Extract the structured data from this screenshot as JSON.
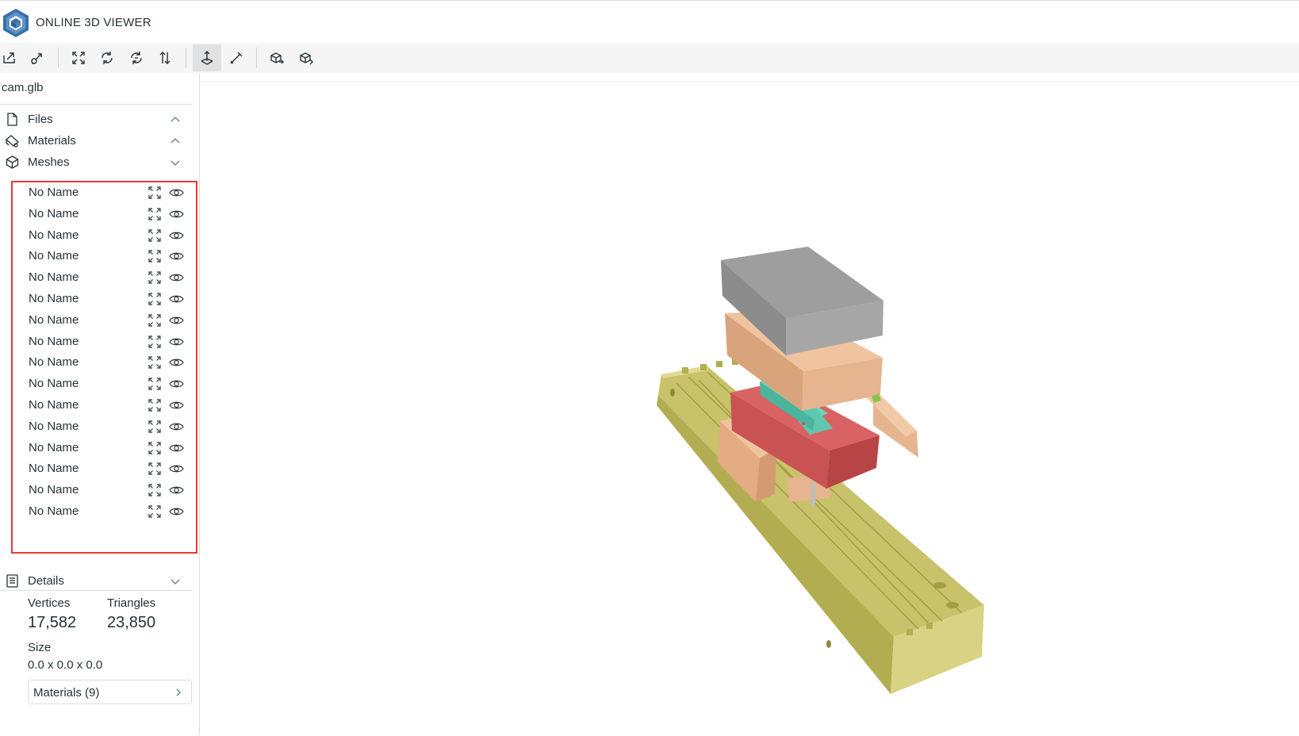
{
  "app": {
    "title": "ONLINE 3D VIEWER"
  },
  "toolbar": {
    "buttons": [
      {
        "name": "open-file-icon"
      },
      {
        "name": "open-url-icon"
      },
      {
        "name": "fit-to-window-icon"
      },
      {
        "name": "set-up-vector-icon"
      },
      {
        "name": "flip-up-vector-icon"
      },
      {
        "name": "up-down-arrows-icon"
      },
      {
        "name": "fixed-up-vector-icon"
      },
      {
        "name": "measure-icon"
      },
      {
        "name": "export-icon"
      },
      {
        "name": "share-embed-icon"
      }
    ]
  },
  "sidebar": {
    "file_name": "cam.glb",
    "sections": {
      "files": "Files",
      "materials": "Materials",
      "meshes": "Meshes",
      "details": "Details"
    },
    "meshes": [
      "No Name",
      "No Name",
      "No Name",
      "No Name",
      "No Name",
      "No Name",
      "No Name",
      "No Name",
      "No Name",
      "No Name",
      "No Name",
      "No Name",
      "No Name",
      "No Name",
      "No Name",
      "No Name"
    ],
    "details": {
      "vertices_label": "Vertices",
      "vertices_value": "17,582",
      "triangles_label": "Triangles",
      "triangles_value": "23,850",
      "size_label": "Size",
      "size_value": "0.0 x 0.0 x 0.0",
      "materials_button": "Materials (9)"
    }
  },
  "colors": {
    "accent_box": "#e53935",
    "base_plate": "#c8c26a",
    "gray_block": "#8c8c8c",
    "tan_block": "#e6b48e",
    "red_block": "#c95353",
    "teal_part": "#5fc7b0"
  }
}
